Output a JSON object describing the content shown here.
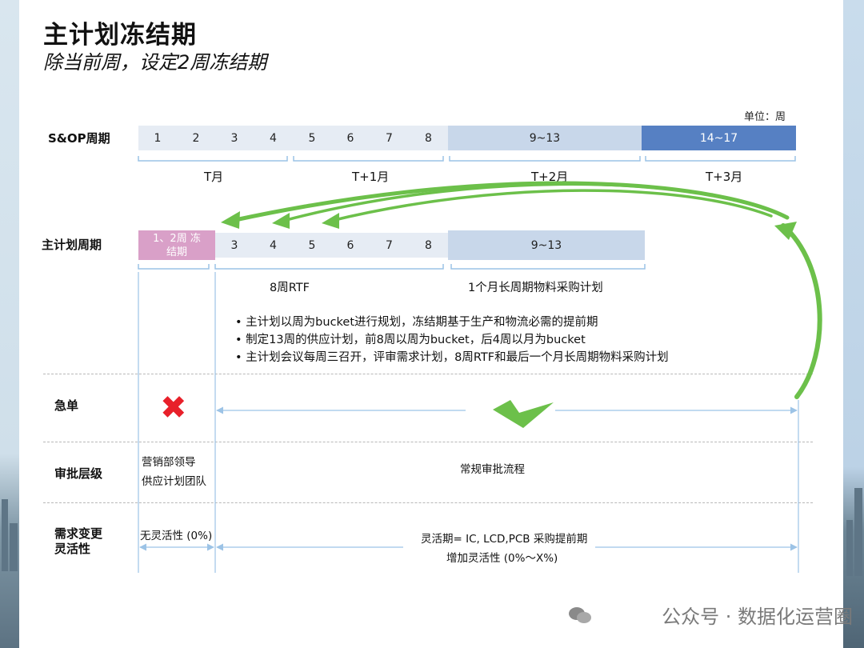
{
  "title": "主计划冻结期",
  "subtitle": "除当前周，设定2周冻结期",
  "unit": "单位：周",
  "sop": {
    "label": "S&OP周期",
    "cells": [
      "1",
      "2",
      "3",
      "4",
      "5",
      "6",
      "7",
      "8",
      "9~13",
      "14~17"
    ],
    "months": [
      "T月",
      "T+1月",
      "T+2月",
      "T+3月"
    ]
  },
  "mps": {
    "label": "主计划周期",
    "freeze": "1、2周 冻结期",
    "cells": [
      "3",
      "4",
      "5",
      "6",
      "7",
      "8",
      "9~13"
    ],
    "notes": [
      "8周RTF",
      "1个月长周期物料采购计划"
    ]
  },
  "bullets": [
    "主计划以周为bucket进行规划，冻结期基于生产和物流必需的提前期",
    "制定13周的供应计划，前8周以周为bucket，后4周以月为bucket",
    "主计划会议每周三召开，评审需求计划，8周RTF和最后一个月长周期物料采购计划"
  ],
  "rush": {
    "label": "急单"
  },
  "approval": {
    "label": "审批层级",
    "frozen": [
      "营销部领导",
      "供应计划团队"
    ],
    "normal": "常规审批流程"
  },
  "flex": {
    "label_line1": "需求变更",
    "label_line2": "灵活性",
    "frozen": "无灵活性 (0%)",
    "line1": "灵活期= IC, LCD,PCB 采购提前期",
    "line2": "增加灵活性 (0%～X%)"
  },
  "watermark": "公众号 · 数据化运营圈",
  "colors": {
    "arrow_green": "#6cc04a",
    "pink": "#d9a0c8",
    "dark_blue": "#5680c3",
    "light_blue": "#e6ecf4",
    "mid_blue": "#c8d7ea",
    "axis_blue": "#9cc3e6"
  }
}
